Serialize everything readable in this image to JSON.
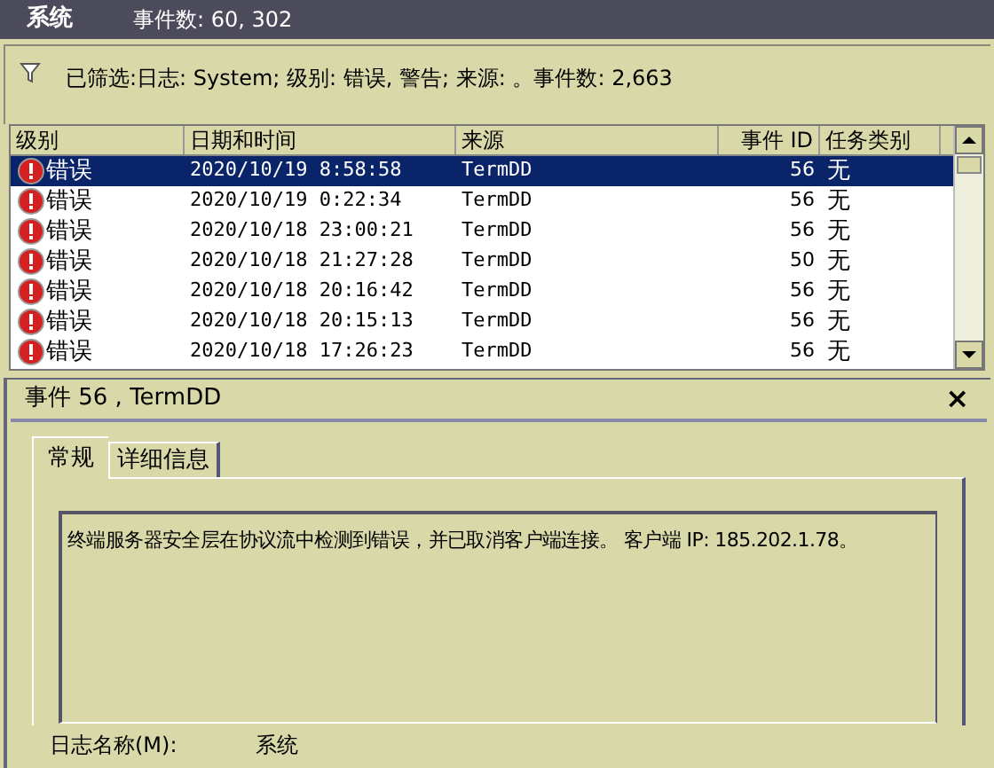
{
  "header": {
    "title": "系统",
    "event_count": "事件数: 60, 302"
  },
  "filter": {
    "text": "已筛选:日志: System; 级别: 错误, 警告; 来源: 。事件数: 2,663"
  },
  "table": {
    "columns": [
      "级别",
      "日期和时间",
      "来源",
      "事件 ID",
      "任务类别"
    ],
    "rows": [
      {
        "level": "错误",
        "datetime": "2020/10/19 8:58:58",
        "source": "TermDD",
        "event_id": "56",
        "task": "无",
        "selected": true
      },
      {
        "level": "错误",
        "datetime": "2020/10/19 0:22:34",
        "source": "TermDD",
        "event_id": "56",
        "task": "无",
        "selected": false
      },
      {
        "level": "错误",
        "datetime": "2020/10/18 23:00:21",
        "source": "TermDD",
        "event_id": "56",
        "task": "无",
        "selected": false
      },
      {
        "level": "错误",
        "datetime": "2020/10/18 21:27:28",
        "source": "TermDD",
        "event_id": "50",
        "task": "无",
        "selected": false
      },
      {
        "level": "错误",
        "datetime": "2020/10/18 20:16:42",
        "source": "TermDD",
        "event_id": "56",
        "task": "无",
        "selected": false
      },
      {
        "level": "错误",
        "datetime": "2020/10/18 20:15:13",
        "source": "TermDD",
        "event_id": "56",
        "task": "无",
        "selected": false
      },
      {
        "level": "错误",
        "datetime": "2020/10/18 17:26:23",
        "source": "TermDD",
        "event_id": "56",
        "task": "无",
        "selected": false
      }
    ]
  },
  "detail": {
    "title": "事件 56 , TermDD",
    "close": "×",
    "tabs": [
      {
        "label": "常规",
        "selected": true
      },
      {
        "label": "详细信息",
        "selected": false
      }
    ],
    "message": "终端服务器安全层在协议流中检测到错误，并已取消客户端连接。 客户端 IP: 185.202.1.78。",
    "field": {
      "label": "日志名称(M):",
      "value": "系统"
    }
  }
}
